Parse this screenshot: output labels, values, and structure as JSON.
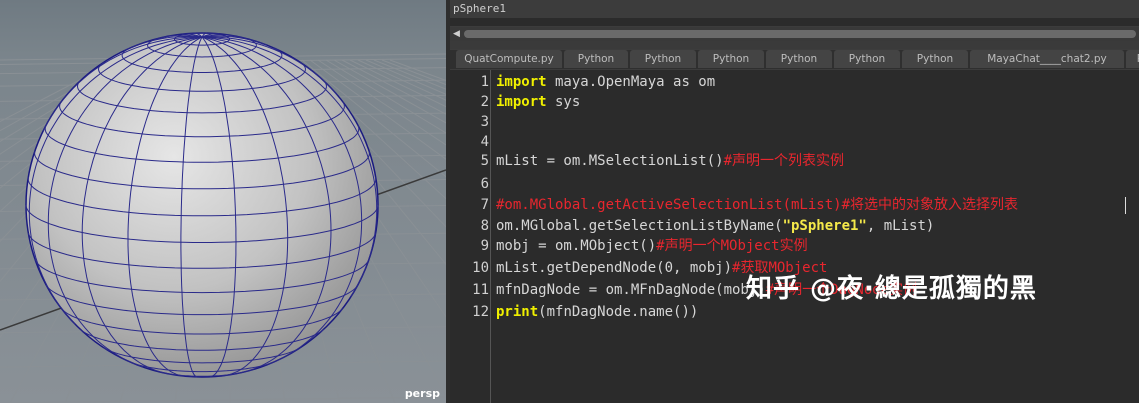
{
  "viewport": {
    "camera_label": "persp"
  },
  "script_editor": {
    "object_name": "pSphere1",
    "tabs": [
      "QuatCompute.py",
      "Python",
      "Python",
      "Python",
      "Python",
      "Python",
      "Python",
      "MayaChat____chat2.py",
      "Py"
    ],
    "line_numbers": [
      "1",
      "2",
      "3",
      "4",
      "5",
      "6",
      "7",
      "8",
      "9",
      "10",
      "11",
      "12"
    ],
    "code": {
      "l1_kw": "import",
      "l1_rest": " maya.OpenMaya as om",
      "l2_kw": "import",
      "l2_rest": " sys",
      "l5_code": "mList = om.MSelectionList()",
      "l5_comment": "#声明一个列表实例",
      "l7_comment": "#om.MGlobal.getActiveSelectionList(mList)#将选中的对象放入选择列表",
      "l8_pre": "om.MGlobal.getSelectionListByName(",
      "l8_str": "\"pSphere1\"",
      "l8_post": ", mList)",
      "l9_code": "mobj = om.MObject()",
      "l9_comment": "#声明一个MObject实例",
      "l10_code": "mList.getDependNode(0, mobj)",
      "l10_comment": "#获取MObject",
      "l11_code": "mfnDagNode = om.MFnDagNode(mobj)",
      "l11_comment": "#声明一个DagNode实例",
      "l12_kw": "print",
      "l12_rest": "(mfnDagNode.name())"
    }
  },
  "watermark": "知乎 @夜·總是孤獨的黑"
}
